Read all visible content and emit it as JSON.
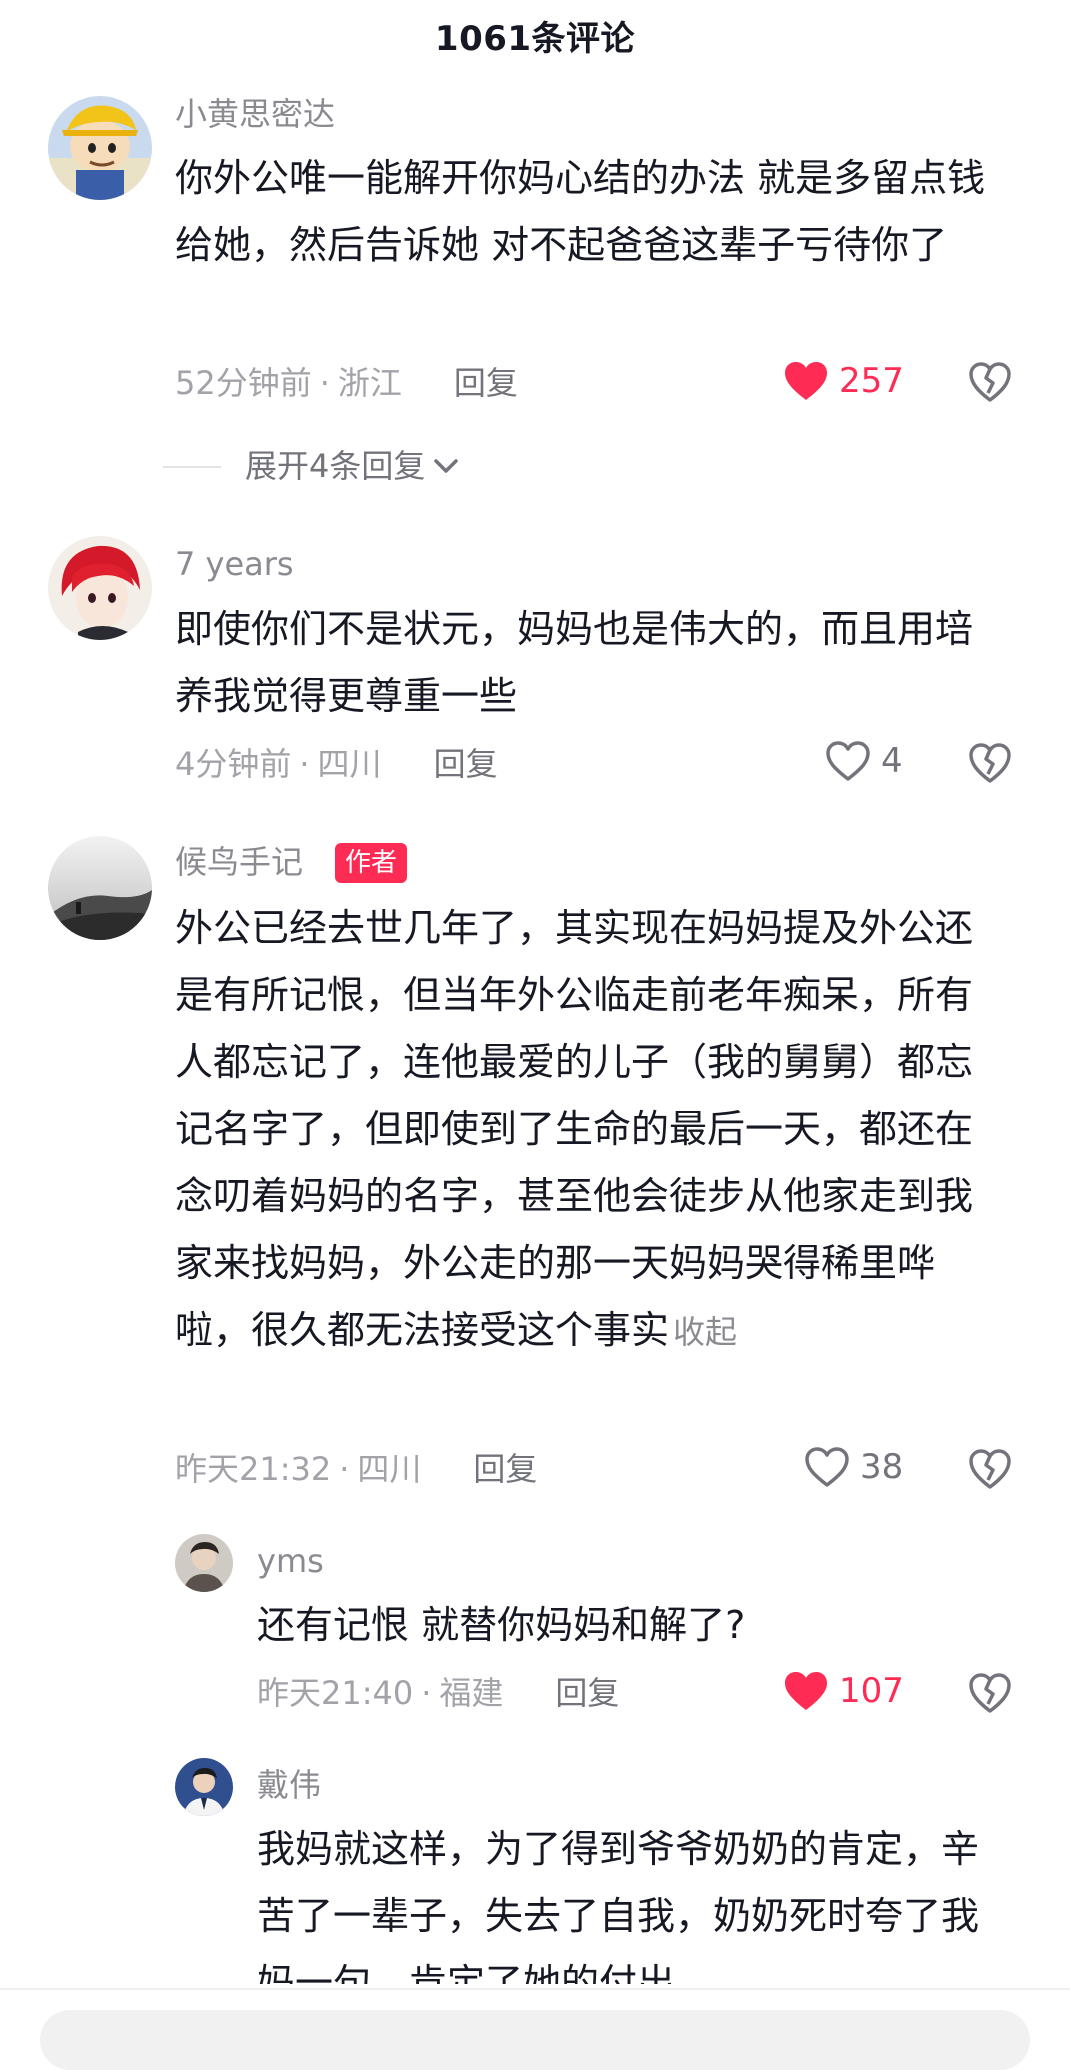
{
  "header": {
    "title": "1061条评论"
  },
  "colors": {
    "accent_red": "#fe2c55",
    "text_primary": "#161823",
    "text_secondary": "#8a8b91"
  },
  "comments": [
    {
      "username": "小黄思密达",
      "avatar_icon": "cartoon-avatar-icon",
      "text": "你外公唯一能解开你妈心结的办法 就是多留点钱给她，然后告诉她 对不起爸爸这辈子亏待你了",
      "time": "52分钟前",
      "location": "浙江",
      "reply_label": "回复",
      "likes": "257",
      "liked": true,
      "expand_label": "展开4条回复"
    },
    {
      "username": "7 years",
      "avatar_icon": "anime-red-hair-avatar-icon",
      "text": "即使你们不是状元，妈妈也是伟大的，而且用培养我觉得更尊重一些",
      "time": "4分钟前",
      "location": "四川",
      "reply_label": "回复",
      "likes": "4",
      "liked": false
    },
    {
      "username": "候鸟手记",
      "author_badge": "作者",
      "avatar_icon": "landscape-avatar-icon",
      "text": "外公已经去世几年了，其实现在妈妈提及外公还是有所记恨，但当年外公临走前老年痴呆，所有人都忘记了，连他最爱的儿子（我的舅舅）都忘记名字了，但即使到了生命的最后一天，都还在念叨着妈妈的名字，甚至他会徒步从他家走到我家来找妈妈，外公走的那一天妈妈哭得稀里哗啦，很久都无法接受这个事实",
      "collapse_label": "收起",
      "time": "昨天21:32",
      "location": "四川",
      "reply_label": "回复",
      "likes": "38",
      "liked": false,
      "replies": [
        {
          "username": "yms",
          "avatar_icon": "person-avatar-icon",
          "text": "还有记恨 就替你妈妈和解了?",
          "time": "昨天21:40",
          "location": "福建",
          "reply_label": "回复",
          "likes": "107",
          "liked": true
        },
        {
          "username": "戴伟",
          "avatar_icon": "person-blue-avatar-icon",
          "text": "我妈就这样，为了得到爷爷奶奶的肯定，辛苦了一辈子，失去了自我，奶奶死时夸了我妈一句，肯定了她的付出"
        }
      ]
    }
  ]
}
